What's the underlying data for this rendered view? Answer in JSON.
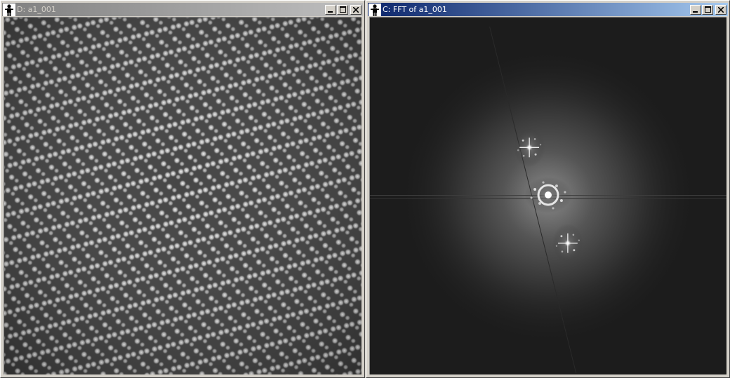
{
  "windows": [
    {
      "id": "image",
      "title": "D: a1_001",
      "active": false,
      "content": "atomic-lattice-micrograph"
    },
    {
      "id": "fft",
      "title": "C: FFT of a1_001",
      "active": true,
      "content": "fft-power-spectrum"
    }
  ],
  "icons": {
    "app": "person-app-icon",
    "minimize": "minimize-icon",
    "maximize": "maximize-icon",
    "close": "close-icon"
  }
}
